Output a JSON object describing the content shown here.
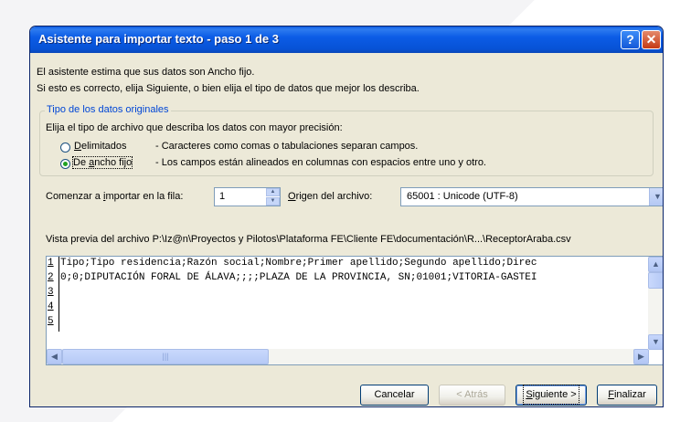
{
  "window": {
    "title": "Asistente para importar texto - paso 1 de 3"
  },
  "titlebar": {
    "help_glyph": "?",
    "close_glyph": "✕",
    "help_icon": "help-icon",
    "close_icon": "close-icon"
  },
  "intro": {
    "line1": "El asistente estima que sus datos son Ancho fijo.",
    "line2": "Si esto es correcto, elija Siguiente, o bien elija el tipo de datos que mejor los describa."
  },
  "group": {
    "legend": "Tipo de los datos originales",
    "prompt": "Elija el tipo de archivo que describa los datos con mayor precisión:",
    "options": [
      {
        "label_u": "D",
        "label_rest": "elimitados",
        "desc": "- Caracteres como comas o tabulaciones separan campos.",
        "checked": false
      },
      {
        "label_pre": "De ",
        "label_u": "a",
        "label_rest": "ncho fijo",
        "desc": "- Los campos están alineados en columnas con espacios entre uno y otro.",
        "checked": true
      }
    ]
  },
  "start_row": {
    "label_pre": "Comenzar a ",
    "label_u": "i",
    "label_rest": "mportar en la fila:",
    "value": "1"
  },
  "origin": {
    "label_u": "O",
    "label_rest": "rigen del archivo:",
    "value": "65001 : Unicode (UTF-8)"
  },
  "preview": {
    "label": "Vista previa del archivo P:\\Iz@n\\Proyectos y Pilotos\\Plataforma FE\\Cliente FE\\documentación\\R...\\ReceptorAraba.csv",
    "row_numbers": [
      "1",
      "2",
      "3",
      "4",
      "5"
    ],
    "lines": [
      "Tipo;Tipo residencia;Razón social;Nombre;Primer apellido;Segundo apellido;Direc",
      "0;0;DIPUTACIÓN FORAL DE ÁLAVA;;;;PLAZA DE LA PROVINCIA, SN;01001;VITORIA-GASTEI",
      "",
      "",
      ""
    ]
  },
  "buttons": {
    "cancel": "Cancelar",
    "back": "< Atrás",
    "next_u": "S",
    "next_rest": "iguiente >",
    "finish_u": "F",
    "finish_rest": "inalizar"
  },
  "colors": {
    "title_bar": "#0752d6",
    "dialog_bg": "#ece9d8",
    "legend_text": "#0046d5",
    "radio_check": "#21a121"
  }
}
